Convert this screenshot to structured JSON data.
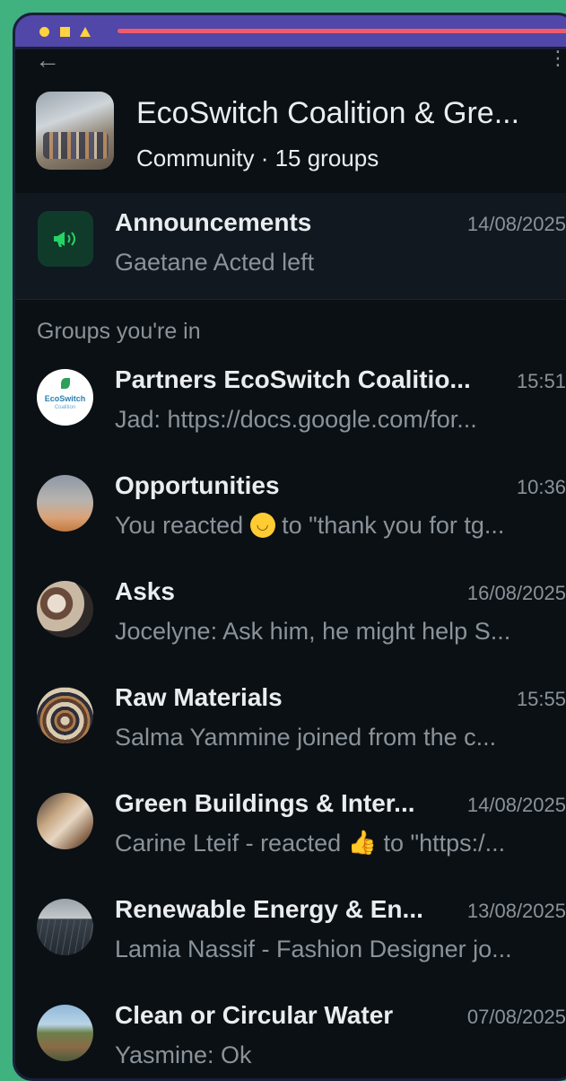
{
  "community": {
    "name": "EcoSwitch Coalition & Gre...",
    "subtitle": "Community · 15 groups"
  },
  "announcements": {
    "title": "Announcements",
    "time": "14/08/2025",
    "message": "Gaetane Acted left"
  },
  "section_label": "Groups you're in",
  "avatar_texts": {
    "eco_logo": "EcoSwitch",
    "eco_logo_sub": "Coalition"
  },
  "groups": [
    {
      "title": "Partners EcoSwitch Coalitio...",
      "time": "15:51",
      "message": "Jad: https://docs.google.com/for..."
    },
    {
      "title": "Opportunities",
      "time": "10:36",
      "message_pre": "You reacted",
      "emoji": "smile-emoji",
      "message_post": "to \"thank you for tg..."
    },
    {
      "title": "Asks",
      "time": "16/08/2025",
      "message": "Jocelyne: Ask him, he might help S..."
    },
    {
      "title": "Raw Materials",
      "time": "15:55",
      "message": "Salma Yammine joined from the c..."
    },
    {
      "title": "Green Buildings & Inter...",
      "time": "14/08/2025",
      "message_pre": "Carine Lteif - reacted",
      "emoji": "thumbs-up-emoji",
      "message_post": "to \"https:/..."
    },
    {
      "title": "Renewable Energy & En...",
      "time": "13/08/2025",
      "message": "Lamia Nassif - Fashion Designer jo..."
    },
    {
      "title": "Clean or Circular Water",
      "time": "07/08/2025",
      "message": "Yasmine: Ok"
    }
  ],
  "colors": {
    "page_bg": "#3fb27f",
    "app_bg": "#0b1014",
    "accent_green": "#25d366",
    "title_bar": "#5147a8"
  }
}
